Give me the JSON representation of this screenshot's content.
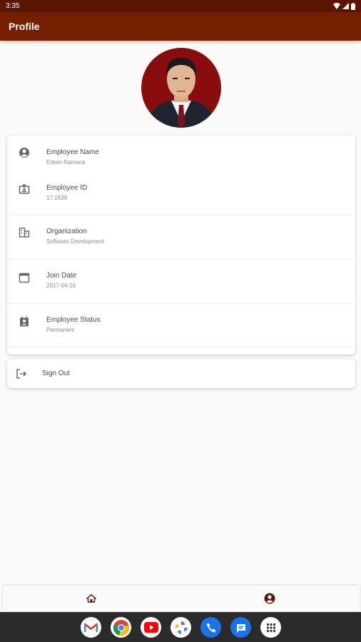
{
  "status_bar": {
    "time": "3:35"
  },
  "app_bar": {
    "title": "Profile"
  },
  "profile": {
    "fields": [
      {
        "label": "Employee Name",
        "value": "Edwin Ramana",
        "icon": "account-circle-icon"
      },
      {
        "label": "Employee ID",
        "value": "17.1639",
        "icon": "badge-icon"
      },
      {
        "label": "Organization",
        "value": "Software Development",
        "icon": "building-icon"
      },
      {
        "label": "Join Date",
        "value": "2017-04-10",
        "icon": "calendar-icon"
      },
      {
        "label": "Employee Status",
        "value": "Permanent",
        "icon": "contact-card-icon"
      }
    ]
  },
  "actions": {
    "sign_out_label": "Sign Out"
  },
  "bottom_nav": {
    "items": [
      "home-icon",
      "account-icon"
    ],
    "active": "account-icon"
  },
  "dock": {
    "apps": [
      "gmail",
      "chrome",
      "youtube",
      "photos",
      "phone",
      "messages",
      "app-drawer"
    ]
  },
  "colors": {
    "primary": "#761f00",
    "status_bar": "#5a1500",
    "background": "#fafafa"
  }
}
